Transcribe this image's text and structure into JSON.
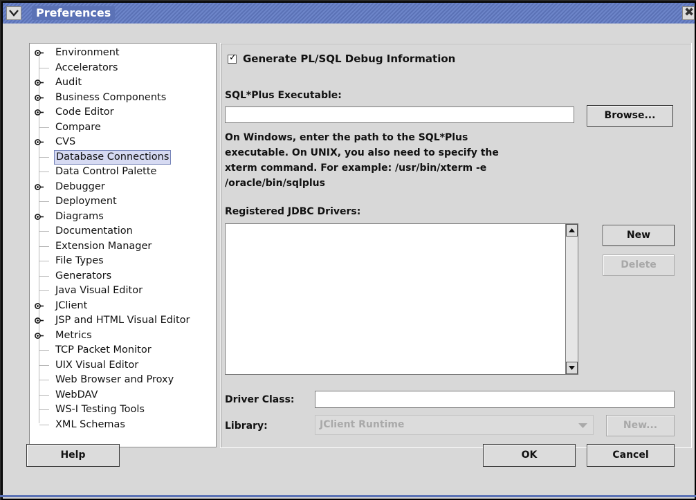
{
  "window": {
    "title": "Preferences"
  },
  "tree": {
    "items": [
      {
        "label": "Environment",
        "expandable": true
      },
      {
        "label": "Accelerators",
        "expandable": false
      },
      {
        "label": "Audit",
        "expandable": true
      },
      {
        "label": "Business Components",
        "expandable": true
      },
      {
        "label": "Code Editor",
        "expandable": true
      },
      {
        "label": "Compare",
        "expandable": false
      },
      {
        "label": "CVS",
        "expandable": true
      },
      {
        "label": "Database Connections",
        "expandable": false,
        "selected": true
      },
      {
        "label": "Data Control Palette",
        "expandable": false
      },
      {
        "label": "Debugger",
        "expandable": true
      },
      {
        "label": "Deployment",
        "expandable": false
      },
      {
        "label": "Diagrams",
        "expandable": true
      },
      {
        "label": "Documentation",
        "expandable": false
      },
      {
        "label": "Extension Manager",
        "expandable": false
      },
      {
        "label": "File Types",
        "expandable": false
      },
      {
        "label": "Generators",
        "expandable": false
      },
      {
        "label": "Java Visual Editor",
        "expandable": false
      },
      {
        "label": "JClient",
        "expandable": true
      },
      {
        "label": "JSP and HTML Visual Editor",
        "expandable": true
      },
      {
        "label": "Metrics",
        "expandable": true
      },
      {
        "label": "TCP Packet Monitor",
        "expandable": false
      },
      {
        "label": "UIX Visual Editor",
        "expandable": false
      },
      {
        "label": "Web Browser and Proxy",
        "expandable": false
      },
      {
        "label": "WebDAV",
        "expandable": false
      },
      {
        "label": "WS-I Testing Tools",
        "expandable": false
      },
      {
        "label": "XML Schemas",
        "expandable": false
      }
    ]
  },
  "panel": {
    "debug_checkbox": {
      "label": "Generate PL/SQL Debug Information",
      "checked": true
    },
    "sqlplus": {
      "label": "SQL*Plus Executable:",
      "value": "",
      "browse_label": "Browse..."
    },
    "description": [
      "On Windows, enter the path to the SQL*Plus",
      "executable.  On UNIX, you also need to specify the",
      "xterm command.  For example: /usr/bin/xterm -e",
      "/oracle/bin/sqlplus"
    ],
    "jdbc": {
      "label": "Registered JDBC Drivers:",
      "new_label": "New",
      "delete_label": "Delete"
    },
    "driver_class": {
      "label": "Driver Class:",
      "value": ""
    },
    "library": {
      "label": "Library:",
      "selected": "JClient Runtime",
      "new_label": "New..."
    }
  },
  "footer": {
    "help_label": "Help",
    "ok_label": "OK",
    "cancel_label": "Cancel"
  }
}
